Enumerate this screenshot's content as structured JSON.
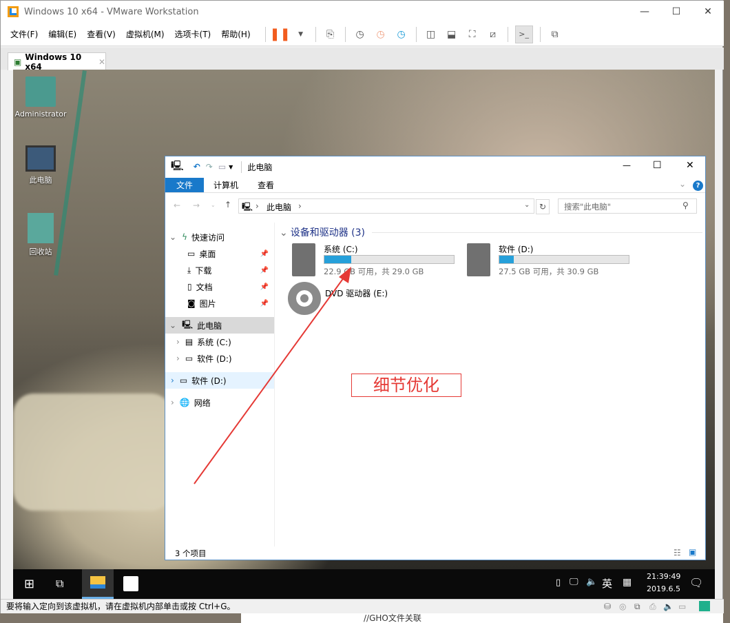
{
  "window": {
    "title": "Windows 10 x64 - VMware Workstation",
    "minimize": "—",
    "maximize": "☐",
    "close": "✕"
  },
  "menu": [
    "文件(F)",
    "编辑(E)",
    "查看(V)",
    "虚拟机(M)",
    "选项卡(T)",
    "帮助(H)"
  ],
  "tab": {
    "label": "Windows 10 x64",
    "close": "✕"
  },
  "desktop": {
    "icons": [
      "Administrator",
      "此电脑",
      "回收站"
    ]
  },
  "explorer": {
    "title": "此电脑",
    "ribbon": [
      "文件",
      "计算机",
      "查看"
    ],
    "address": [
      "此电脑"
    ],
    "search_placeholder": "搜索\"此电脑\"",
    "nav": {
      "quick_access": "快速访问",
      "quick_items": [
        "桌面",
        "下载",
        "文档",
        "图片"
      ],
      "this_pc": "此电脑",
      "pc_items": [
        "系统 (C:)",
        "软件 (D:)"
      ],
      "drive_d": "软件 (D:)",
      "network": "网络"
    },
    "group_title": "设备和驱动器 (3)",
    "drives": [
      {
        "name": "系统 (C:)",
        "info": "22.9 GB 可用，共 29.0 GB",
        "used_percent": 21
      },
      {
        "name": "软件 (D:)",
        "info": "27.5 GB 可用，共 30.9 GB",
        "used_percent": 11
      },
      {
        "name": "DVD 驱动器 (E:)"
      }
    ],
    "status": "3 个项目"
  },
  "annotation": {
    "text": "细节优化",
    "color": "#e53935"
  },
  "taskbar": {
    "time": "21:39:49",
    "date": "2019.6.5",
    "ime": "英"
  },
  "statusbar": {
    "message": "要将输入定向到该虚拟机，请在虚拟机内部单击或按 Ctrl+G。"
  },
  "behind": {
    "text": "//GHO文件关联"
  }
}
